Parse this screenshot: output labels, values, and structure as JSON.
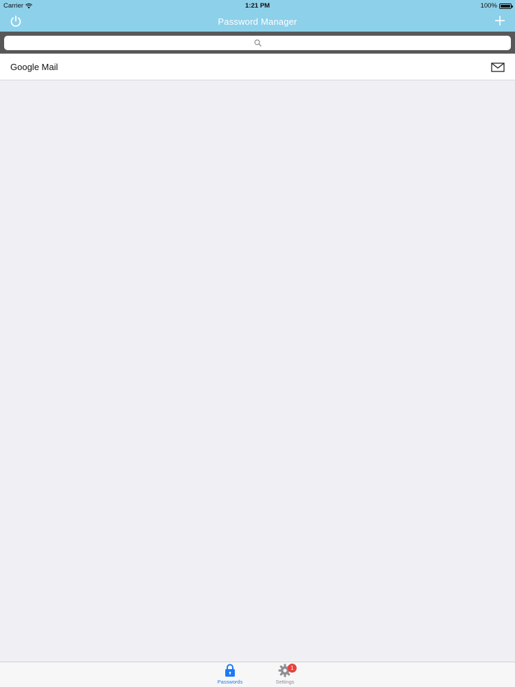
{
  "status_bar": {
    "carrier": "Carrier",
    "time": "1:21 PM",
    "battery": "100%"
  },
  "nav": {
    "title": "Password Manager",
    "left_icon": "power-icon",
    "right_icon": "plus-icon"
  },
  "search": {
    "placeholder": "",
    "value": "",
    "icon": "search-icon"
  },
  "list": {
    "items": [
      {
        "label": "Google Mail",
        "icon": "mail-icon"
      }
    ]
  },
  "tabbar": {
    "tabs": [
      {
        "label": "Passwords",
        "icon": "lock-icon",
        "active": true
      },
      {
        "label": "Settings",
        "icon": "gear-icon",
        "badge": "1"
      }
    ]
  },
  "colors": {
    "nav_background": "#8dd0ea",
    "search_strip": "#585858",
    "content_background": "#efeff4",
    "accent": "#1a7cf5",
    "badge": "#e7423b"
  }
}
